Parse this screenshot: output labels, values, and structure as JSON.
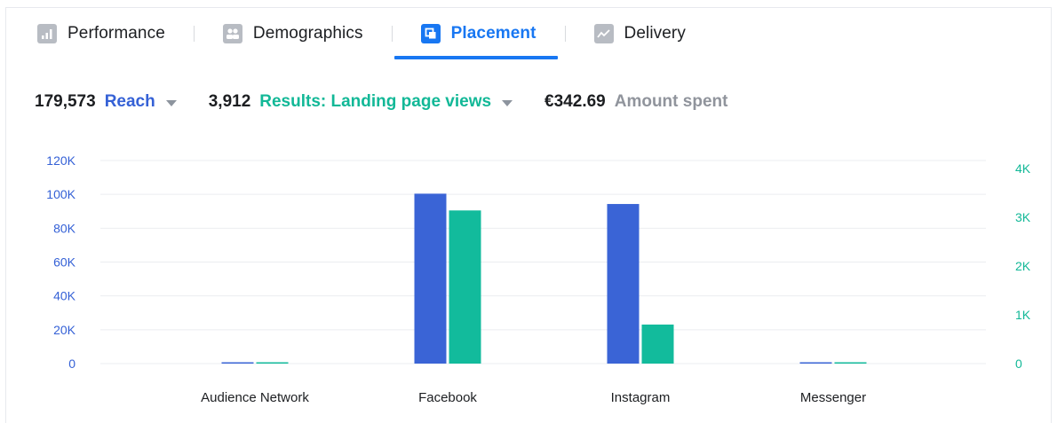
{
  "tabs": [
    {
      "label": "Performance",
      "icon": "bar-chart-icon",
      "active": false
    },
    {
      "label": "Demographics",
      "icon": "people-icon",
      "active": false
    },
    {
      "label": "Placement",
      "icon": "placement-icon",
      "active": true
    },
    {
      "label": "Delivery",
      "icon": "line-chart-icon",
      "active": false
    }
  ],
  "metrics": {
    "reach": {
      "value": "179,573",
      "label": "Reach"
    },
    "results": {
      "value": "3,912",
      "label": "Results: Landing page views"
    },
    "spent": {
      "value": "€342.69",
      "label": "Amount spent"
    }
  },
  "colors": {
    "reach": "#3a64d6",
    "results": "#12bb9c",
    "active_tab": "#1877f2",
    "spent_label": "#90949c"
  },
  "chart_data": {
    "type": "bar",
    "categories": [
      "Audience Network",
      "Facebook",
      "Instagram",
      "Messenger"
    ],
    "series": [
      {
        "values": [
          600,
          100400,
          94300,
          700
        ],
        "axis": "left"
      },
      {
        "values": [
          20,
          3140,
          800,
          20
        ],
        "axis": "right"
      }
    ],
    "y_left": {
      "ticks": [
        "0",
        "20K",
        "40K",
        "60K",
        "80K",
        "100K",
        "120K"
      ],
      "lim": [
        0,
        120000
      ],
      "step": 20000
    },
    "y_right": {
      "ticks": [
        "0",
        "1K",
        "2K",
        "3K",
        "4K"
      ],
      "lim": [
        0,
        4000
      ],
      "step": 1000
    },
    "grid": true,
    "legend": "none"
  }
}
